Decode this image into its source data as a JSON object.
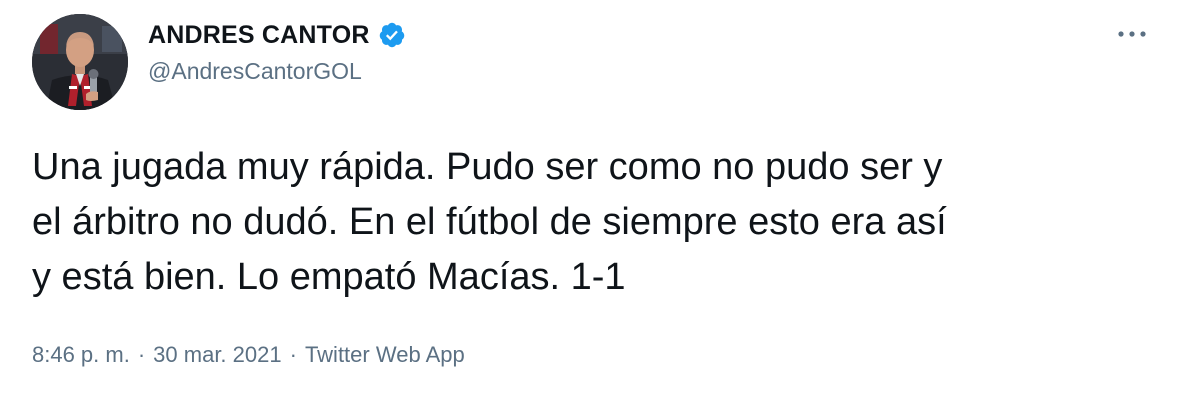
{
  "tweet": {
    "author": {
      "display_name": "ANDRES CANTOR",
      "handle": "@AndresCantorGOL",
      "verified": true,
      "verified_icon": "verified-badge-icon",
      "avatar_icon": "profile-photo"
    },
    "more_icon": "more-options-icon",
    "text": "Una jugada muy rápida. Pudo ser como no pudo ser y\nel árbitro no dudó. En el fútbol de siempre esto era así\ny está bien. Lo empató Macías. 1-1",
    "time": "8:46 p. m.",
    "separator": "·",
    "date": "30 mar. 2021",
    "source": "Twitter Web App"
  },
  "colors": {
    "accent": "#1d9bf0",
    "secondary_text": "#5b7083",
    "primary_text": "#0f1419"
  }
}
